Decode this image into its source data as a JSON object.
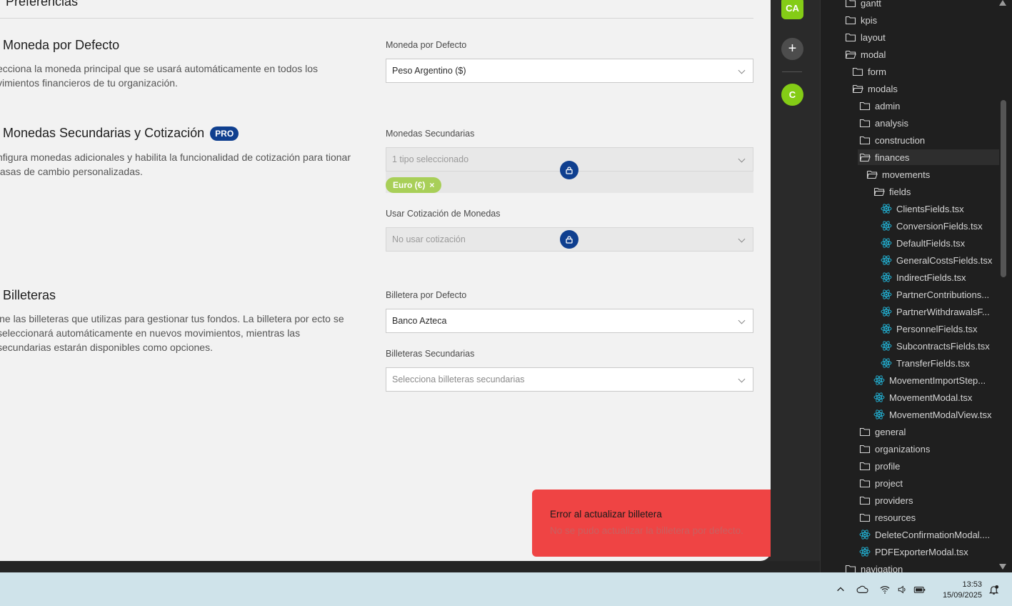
{
  "page": {
    "title": "Preferencias"
  },
  "currency": {
    "title": "Moneda por Defecto",
    "description": "ecciona la moneda principal que se usará automáticamente en todos los vimientos financieros de tu organización.",
    "label": "Moneda por Defecto",
    "value": "Peso Argentino ($)"
  },
  "secondary": {
    "title": "Monedas Secundarias y Cotización",
    "badge": "PRO",
    "description": "nfigura monedas adicionales y habilita la funcionalidad de cotización para tionar tasas de cambio personalizadas.",
    "label": "Monedas Secundarias",
    "placeholder": "1 tipo seleccionado",
    "tag": "Euro (€)",
    "tag_remove": "×",
    "rate_label": "Usar Cotización de Monedas",
    "rate_value": "No usar cotización"
  },
  "wallets": {
    "title": "Billeteras",
    "description": "ine las billeteras que utilizas para gestionar tus fondos. La billetera por ecto se seleccionará automáticamente en nuevos movimientos, mientras las secundarias estarán disponibles como opciones.",
    "label": "Billetera por Defecto",
    "value": "Banco Azteca",
    "secondary_label": "Billeteras Secundarias",
    "secondary_placeholder": "Selecciona billeteras secundarias"
  },
  "toast": {
    "title": "Error al actualizar billetera",
    "message": "No se pudo actualizar la billetera por defecto."
  },
  "rail": {
    "org_initials": "CA",
    "add": "+",
    "user_initial": "C"
  },
  "explorer": {
    "items": [
      {
        "label": "gantt",
        "type": "folder"
      },
      {
        "label": "kpis",
        "type": "folder"
      },
      {
        "label": "layout",
        "type": "folder"
      },
      {
        "label": "modal",
        "type": "folder-open"
      },
      {
        "label": "form",
        "type": "folder"
      },
      {
        "label": "modals",
        "type": "folder-open"
      },
      {
        "label": "admin",
        "type": "folder"
      },
      {
        "label": "analysis",
        "type": "folder"
      },
      {
        "label": "construction",
        "type": "folder"
      },
      {
        "label": "finances",
        "type": "folder-open"
      },
      {
        "label": "movements",
        "type": "folder-open"
      },
      {
        "label": "fields",
        "type": "folder-open"
      },
      {
        "label": "ClientsFields.tsx",
        "type": "react"
      },
      {
        "label": "ConversionFields.tsx",
        "type": "react"
      },
      {
        "label": "DefaultFields.tsx",
        "type": "react"
      },
      {
        "label": "GeneralCostsFields.tsx",
        "type": "react"
      },
      {
        "label": "IndirectFields.tsx",
        "type": "react"
      },
      {
        "label": "PartnerContributions...",
        "type": "react"
      },
      {
        "label": "PartnerWithdrawalsF...",
        "type": "react"
      },
      {
        "label": "PersonnelFields.tsx",
        "type": "react"
      },
      {
        "label": "SubcontractsFields.tsx",
        "type": "react"
      },
      {
        "label": "TransferFields.tsx",
        "type": "react"
      },
      {
        "label": "MovementImportStep...",
        "type": "react"
      },
      {
        "label": "MovementModal.tsx",
        "type": "react"
      },
      {
        "label": "MovementModalView.tsx",
        "type": "react"
      },
      {
        "label": "general",
        "type": "folder"
      },
      {
        "label": "organizations",
        "type": "folder"
      },
      {
        "label": "profile",
        "type": "folder"
      },
      {
        "label": "project",
        "type": "folder"
      },
      {
        "label": "providers",
        "type": "folder"
      },
      {
        "label": "resources",
        "type": "folder"
      },
      {
        "label": "DeleteConfirmationModal....",
        "type": "react"
      },
      {
        "label": "PDFExporterModal.tsx",
        "type": "react"
      },
      {
        "label": "navigation",
        "type": "folder"
      }
    ]
  },
  "taskbar": {
    "time": "13:53",
    "date": "15/09/2025"
  },
  "colors": {
    "accent": "#0f3f8f",
    "brand_green": "#84cc16",
    "error": "#ef4444",
    "tag": "#a8cf58",
    "react": "#22b5d8"
  }
}
